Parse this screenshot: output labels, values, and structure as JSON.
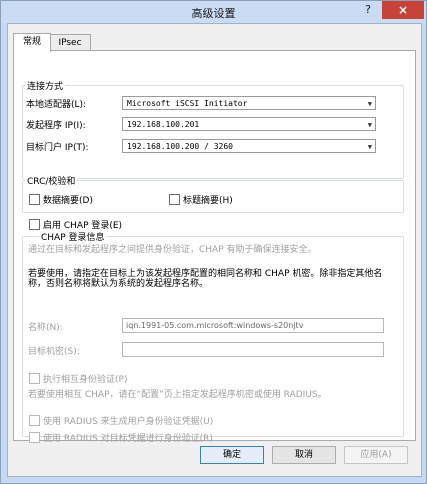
{
  "window": {
    "title": "高级设置",
    "help_label": "?",
    "close_label": "×"
  },
  "tabs": [
    {
      "label": "常规",
      "active": true
    },
    {
      "label": "IPsec",
      "active": false
    }
  ],
  "connect": {
    "title": "连接方式",
    "rows": [
      {
        "label": "本地适配器(L):",
        "value": "Microsoft iSCSI Initiator"
      },
      {
        "label": "发起程序 IP(I):",
        "value": "192.168.100.201"
      },
      {
        "label": "目标门户 IP(T):",
        "value": "192.168.100.200 / 3260"
      }
    ]
  },
  "crc": {
    "title": "CRC/校验和",
    "data_digest": "数据摘要(D)",
    "header_digest": "标题摘要(H)"
  },
  "chap": {
    "enable_label": "启用 CHAP 登录(E)",
    "info_title": "CHAP 登录信息",
    "desc": "通过在目标和发起程序之间提供身份验证，CHAP 有助于确保连接安全。",
    "instructions": "若要使用，请指定在目标上为该发起程序配置的相同名称和 CHAP 机密。除非指定其他名称，否则名称将默认为系统的发起程序名称。",
    "name_label": "名称(N):",
    "name_value": "iqn.1991-05.com.microsoft:windows-s20njtv",
    "secret_label": "目标机密(S):",
    "secret_value": "",
    "mutual_label": "执行相互身份验证(P)",
    "mutual_desc": "若要使用相互 CHAP，请在“配置”页上指定发起程序机密或使用 RADIUS。",
    "radius_user": "使用 RADIUS 来生成用户身份验证凭据(U)",
    "radius_target": "使用 RADIUS 对目标凭据进行身份验证(R)"
  },
  "buttons": {
    "ok": "确定",
    "cancel": "取消",
    "apply": "应用(A)"
  },
  "colors": {
    "titlebar": "#c9dcf3",
    "close": "#c7433a",
    "panel": "#f0f0f0",
    "disabled_text": "#a0a0a0"
  }
}
